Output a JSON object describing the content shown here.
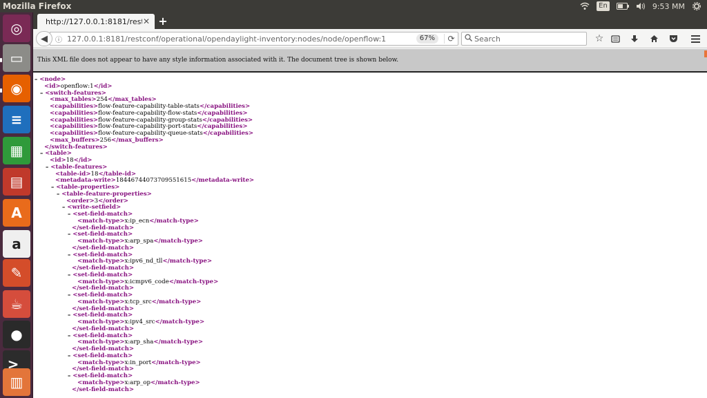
{
  "topbar": {
    "app_title": "Mozilla Firefox",
    "keyboard_layout": "En",
    "clock": "9:53 MM"
  },
  "launcher": {
    "items": [
      {
        "icon": "ubuntu-dash-icon",
        "color": "#7a2a55"
      },
      {
        "icon": "file-manager-icon",
        "color": "#8c8c88"
      },
      {
        "icon": "firefox-icon",
        "color": "#e66000"
      },
      {
        "icon": "libreoffice-writer-icon",
        "color": "#1f6fbd"
      },
      {
        "icon": "libreoffice-calc-icon",
        "color": "#2f9a3a"
      },
      {
        "icon": "libreoffice-impress-icon",
        "color": "#c0392b"
      },
      {
        "icon": "software-center-icon",
        "color": "#e96b1b"
      },
      {
        "icon": "amazon-icon",
        "color": "#efefef"
      },
      {
        "icon": "system-settings-icon",
        "color": "#d44d2a"
      },
      {
        "icon": "java-app-icon",
        "color": "#d54d3c"
      },
      {
        "icon": "disk-icon",
        "color": "#2a2a2a"
      },
      {
        "icon": "terminal-icon",
        "color": "#2c2c2c"
      },
      {
        "icon": "workspaces-icon",
        "color": "#e3753a"
      }
    ]
  },
  "browser": {
    "tab_title": "http://127.0.0.1:8181/restc",
    "url": "127.0.0.1:8181/restconf/operational/opendaylight-inventory:nodes/node/openflow:1",
    "zoom": "67%",
    "search_placeholder": "Search",
    "notice": "This XML file does not appear to have any style information associated with it. The document tree is shown below."
  },
  "xml_lines": [
    {
      "indent": 0,
      "toggle": "–",
      "open": "<node>",
      "text": "",
      "close": ""
    },
    {
      "indent": 1,
      "toggle": "",
      "open": "<id>",
      "text": "openflow:1",
      "close": "</id>"
    },
    {
      "indent": 1,
      "toggle": "–",
      "open": "<switch-features>",
      "text": "",
      "close": ""
    },
    {
      "indent": 2,
      "toggle": "",
      "open": "<max_tables>",
      "text": "254",
      "close": "</max_tables>"
    },
    {
      "indent": 2,
      "toggle": "",
      "open": "<capabilities>",
      "text": "flow-feature-capability-table-stats",
      "close": "</capabilities>"
    },
    {
      "indent": 2,
      "toggle": "",
      "open": "<capabilities>",
      "text": "flow-feature-capability-flow-stats",
      "close": "</capabilities>"
    },
    {
      "indent": 2,
      "toggle": "",
      "open": "<capabilities>",
      "text": "flow-feature-capability-group-stats",
      "close": "</capabilities>"
    },
    {
      "indent": 2,
      "toggle": "",
      "open": "<capabilities>",
      "text": "flow-feature-capability-port-stats",
      "close": "</capabilities>"
    },
    {
      "indent": 2,
      "toggle": "",
      "open": "<capabilities>",
      "text": "flow-feature-capability-queue-stats",
      "close": "</capabilities>"
    },
    {
      "indent": 2,
      "toggle": "",
      "open": "<max_buffers>",
      "text": "256",
      "close": "</max_buffers>"
    },
    {
      "indent": 1,
      "toggle": "",
      "open": "</switch-features>",
      "text": "",
      "close": ""
    },
    {
      "indent": 1,
      "toggle": "–",
      "open": "<table>",
      "text": "",
      "close": ""
    },
    {
      "indent": 2,
      "toggle": "",
      "open": "<id>",
      "text": "18",
      "close": "</id>"
    },
    {
      "indent": 2,
      "toggle": "–",
      "open": "<table-features>",
      "text": "",
      "close": ""
    },
    {
      "indent": 3,
      "toggle": "",
      "open": "<table-id>",
      "text": "18",
      "close": "</table-id>"
    },
    {
      "indent": 3,
      "toggle": "",
      "open": "<metadata-write>",
      "text": "18446744073709551615",
      "close": "</metadata-write>"
    },
    {
      "indent": 3,
      "toggle": "–",
      "open": "<table-properties>",
      "text": "",
      "close": ""
    },
    {
      "indent": 4,
      "toggle": "–",
      "open": "<table-feature-properties>",
      "text": "",
      "close": ""
    },
    {
      "indent": 5,
      "toggle": "",
      "open": "<order>",
      "text": "3",
      "close": "</order>"
    },
    {
      "indent": 5,
      "toggle": "–",
      "open": "<write-setfield>",
      "text": "",
      "close": ""
    },
    {
      "indent": 6,
      "toggle": "–",
      "open": "<set-field-match>",
      "text": "",
      "close": ""
    },
    {
      "indent": 7,
      "toggle": "",
      "open": "<match-type>",
      "text": "x:ip_ecn",
      "close": "</match-type>"
    },
    {
      "indent": 6,
      "toggle": "",
      "open": "</set-field-match>",
      "text": "",
      "close": ""
    },
    {
      "indent": 6,
      "toggle": "–",
      "open": "<set-field-match>",
      "text": "",
      "close": ""
    },
    {
      "indent": 7,
      "toggle": "",
      "open": "<match-type>",
      "text": "x:arp_spa",
      "close": "</match-type>"
    },
    {
      "indent": 6,
      "toggle": "",
      "open": "</set-field-match>",
      "text": "",
      "close": ""
    },
    {
      "indent": 6,
      "toggle": "–",
      "open": "<set-field-match>",
      "text": "",
      "close": ""
    },
    {
      "indent": 7,
      "toggle": "",
      "open": "<match-type>",
      "text": "x:ipv6_nd_tll",
      "close": "</match-type>"
    },
    {
      "indent": 6,
      "toggle": "",
      "open": "</set-field-match>",
      "text": "",
      "close": ""
    },
    {
      "indent": 6,
      "toggle": "–",
      "open": "<set-field-match>",
      "text": "",
      "close": ""
    },
    {
      "indent": 7,
      "toggle": "",
      "open": "<match-type>",
      "text": "x:icmpv6_code",
      "close": "</match-type>"
    },
    {
      "indent": 6,
      "toggle": "",
      "open": "</set-field-match>",
      "text": "",
      "close": ""
    },
    {
      "indent": 6,
      "toggle": "–",
      "open": "<set-field-match>",
      "text": "",
      "close": ""
    },
    {
      "indent": 7,
      "toggle": "",
      "open": "<match-type>",
      "text": "x:tcp_src",
      "close": "</match-type>"
    },
    {
      "indent": 6,
      "toggle": "",
      "open": "</set-field-match>",
      "text": "",
      "close": ""
    },
    {
      "indent": 6,
      "toggle": "–",
      "open": "<set-field-match>",
      "text": "",
      "close": ""
    },
    {
      "indent": 7,
      "toggle": "",
      "open": "<match-type>",
      "text": "x:ipv4_src",
      "close": "</match-type>"
    },
    {
      "indent": 6,
      "toggle": "",
      "open": "</set-field-match>",
      "text": "",
      "close": ""
    },
    {
      "indent": 6,
      "toggle": "–",
      "open": "<set-field-match>",
      "text": "",
      "close": ""
    },
    {
      "indent": 7,
      "toggle": "",
      "open": "<match-type>",
      "text": "x:arp_sha",
      "close": "</match-type>"
    },
    {
      "indent": 6,
      "toggle": "",
      "open": "</set-field-match>",
      "text": "",
      "close": ""
    },
    {
      "indent": 6,
      "toggle": "–",
      "open": "<set-field-match>",
      "text": "",
      "close": ""
    },
    {
      "indent": 7,
      "toggle": "",
      "open": "<match-type>",
      "text": "x:in_port",
      "close": "</match-type>"
    },
    {
      "indent": 6,
      "toggle": "",
      "open": "</set-field-match>",
      "text": "",
      "close": ""
    },
    {
      "indent": 6,
      "toggle": "–",
      "open": "<set-field-match>",
      "text": "",
      "close": ""
    },
    {
      "indent": 7,
      "toggle": "",
      "open": "<match-type>",
      "text": "x:arp_op",
      "close": "</match-type>"
    },
    {
      "indent": 6,
      "toggle": "",
      "open": "</set-field-match>",
      "text": "",
      "close": ""
    }
  ]
}
